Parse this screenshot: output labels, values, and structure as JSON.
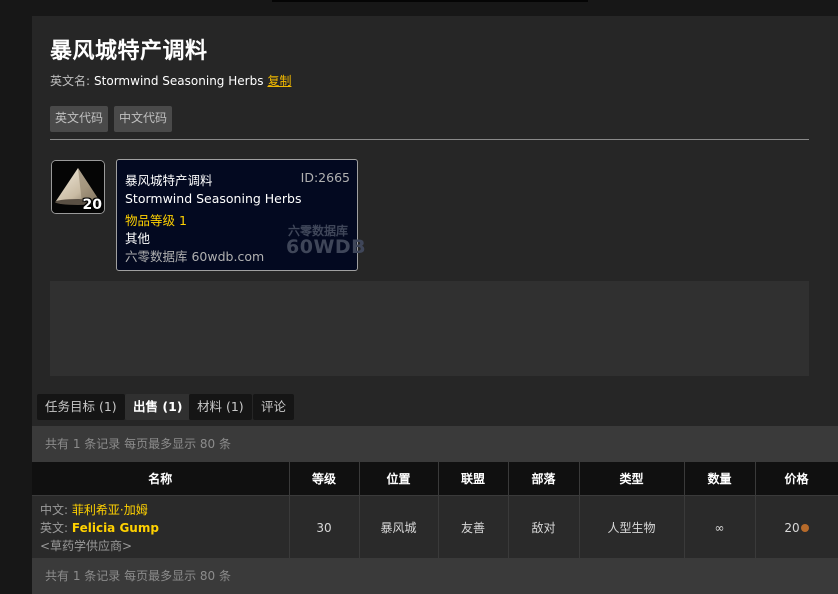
{
  "item": {
    "title": "暴风城特产调料",
    "english_name_label": "英文名:",
    "english_name": "Stormwind Seasoning Herbs",
    "copy_label": "复制",
    "code_buttons": {
      "english_code": "英文代码",
      "chinese_code": "中文代码"
    },
    "icon": "seasoning-pile-icon",
    "stack_count": "20"
  },
  "tooltip": {
    "name": "暴风城特产调料",
    "id": "ID:2665",
    "english_name": "Stormwind Seasoning Herbs",
    "item_level": "物品等级 1",
    "item_class": "其他",
    "site": "六零数据库 60wdb.com",
    "watermark_cn": "六零数据库",
    "watermark_en": "60WDB"
  },
  "tabs": [
    {
      "label": "任务目标 (1)",
      "active": false
    },
    {
      "label": "出售 (1)",
      "active": true
    },
    {
      "label": "材料 (1)",
      "active": false
    },
    {
      "label": "评论",
      "active": false
    }
  ],
  "summary": "共有 1 条记录 每页最多显示 80 条",
  "vendors_table": {
    "columns": [
      "名称",
      "等级",
      "位置",
      "联盟",
      "部落",
      "类型",
      "数量",
      "价格"
    ],
    "rows": [
      {
        "cn_label": "中文:",
        "cn_name": "菲利希亚·加姆",
        "en_label": "英文:",
        "en_name": "Felicia Gump",
        "npc_title": "<草药学供应商>",
        "level": "30",
        "location": "暴风城",
        "alliance": "友善",
        "horde": "敌对",
        "type": "人型生物",
        "quantity": "∞",
        "price": "20",
        "price_coin": "copper-coin-icon"
      }
    ]
  },
  "colors": {
    "accent_gold": "#ffd100",
    "link_gold": "#f0b800",
    "friendly": "#1eff00",
    "hostile": "#ff2020",
    "tooltip_bg": "#030920"
  }
}
